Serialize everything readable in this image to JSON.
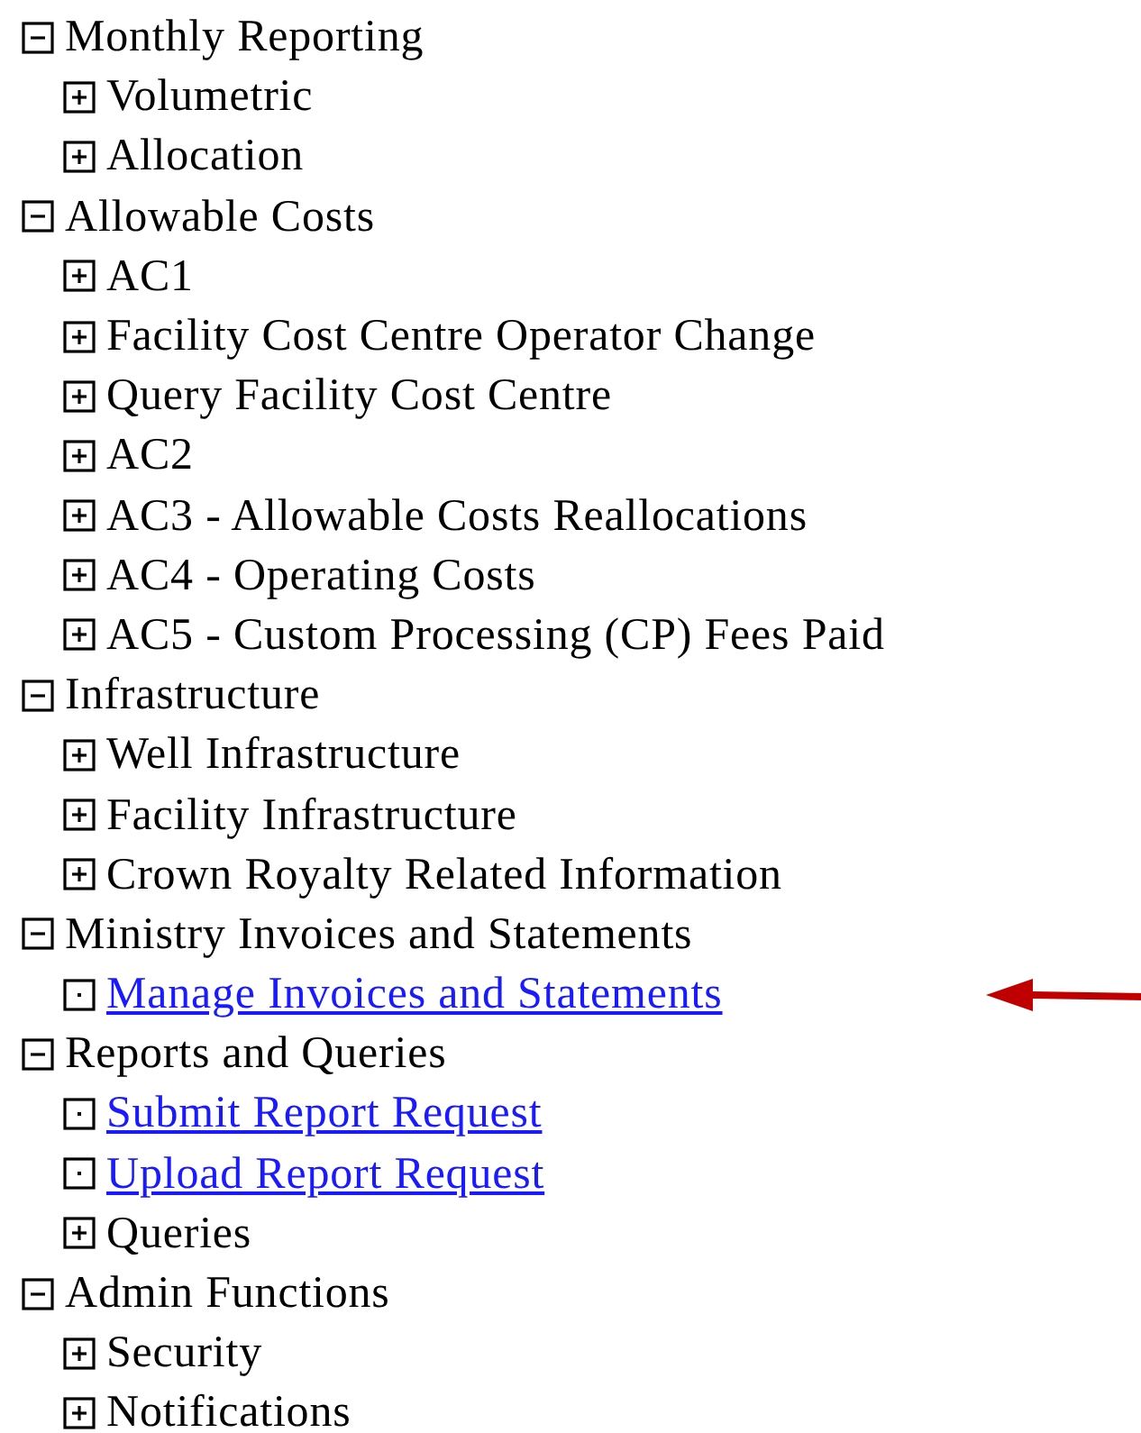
{
  "tree": [
    {
      "label": "Monthly Reporting",
      "expanded": true,
      "children": [
        {
          "kind": "folder",
          "label": "Volumetric",
          "expanded": false,
          "arrow": false
        },
        {
          "kind": "folder",
          "label": "Allocation",
          "expanded": false,
          "arrow": false
        }
      ]
    },
    {
      "label": "Allowable Costs",
      "expanded": true,
      "children": [
        {
          "kind": "folder",
          "label": "AC1",
          "expanded": false,
          "arrow": false
        },
        {
          "kind": "folder",
          "label": "Facility Cost Centre Operator Change",
          "expanded": false,
          "arrow": false
        },
        {
          "kind": "folder",
          "label": "Query Facility Cost Centre",
          "expanded": false,
          "arrow": false
        },
        {
          "kind": "folder",
          "label": "AC2",
          "expanded": false,
          "arrow": false
        },
        {
          "kind": "folder",
          "label": "AC3 - Allowable Costs Reallocations",
          "expanded": false,
          "arrow": false
        },
        {
          "kind": "folder",
          "label": "AC4 - Operating Costs",
          "expanded": false,
          "arrow": false
        },
        {
          "kind": "folder",
          "label": "AC5 - Custom Processing (CP) Fees Paid",
          "expanded": false,
          "arrow": false
        }
      ]
    },
    {
      "label": "Infrastructure",
      "expanded": true,
      "children": [
        {
          "kind": "folder",
          "label": "Well Infrastructure",
          "expanded": false,
          "arrow": false
        },
        {
          "kind": "folder",
          "label": "Facility Infrastructure",
          "expanded": false,
          "arrow": false
        },
        {
          "kind": "folder",
          "label": "Crown Royalty Related Information",
          "expanded": false,
          "arrow": false
        }
      ]
    },
    {
      "label": "Ministry Invoices and Statements",
      "expanded": true,
      "children": [
        {
          "kind": "link",
          "label": "Manage Invoices and Statements",
          "arrow": true
        }
      ]
    },
    {
      "label": "Reports and Queries",
      "expanded": true,
      "children": [
        {
          "kind": "link",
          "label": "Submit Report Request",
          "arrow": false
        },
        {
          "kind": "link",
          "label": "Upload Report Request",
          "arrow": false
        },
        {
          "kind": "folder",
          "label": "Queries",
          "expanded": false,
          "arrow": false
        }
      ]
    },
    {
      "label": "Admin Functions",
      "expanded": true,
      "children": [
        {
          "kind": "folder",
          "label": "Security",
          "expanded": false,
          "arrow": false
        },
        {
          "kind": "folder",
          "label": "Notifications",
          "expanded": false,
          "arrow": false
        }
      ]
    }
  ]
}
